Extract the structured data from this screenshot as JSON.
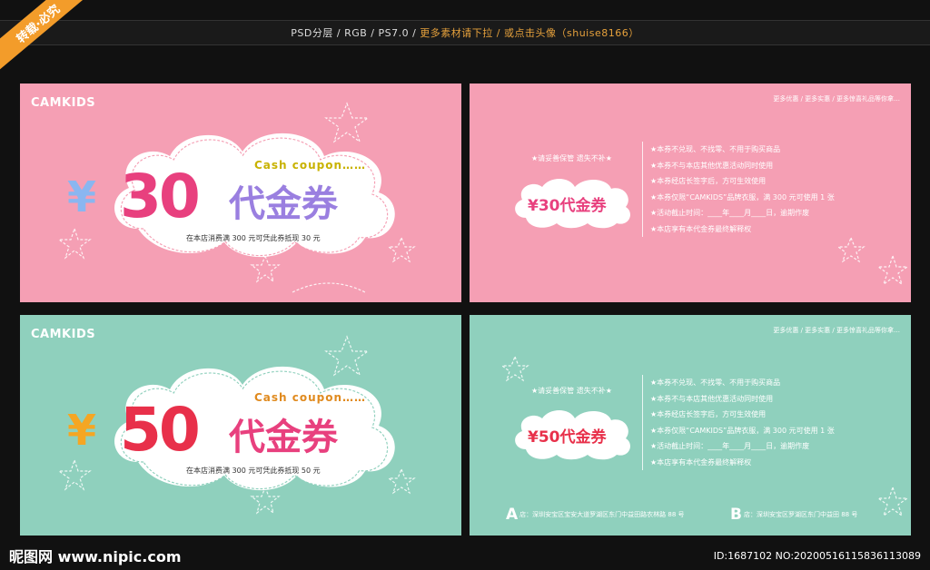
{
  "ribbon": "转载·必究",
  "topbar": {
    "specs": "PSD分层 / RGB / PS7.0 / ",
    "more": "更多素材请下拉 / 或点击头像（shuise8166）"
  },
  "cards": {
    "front30": {
      "brand": "CAMKIDS",
      "cash": "Cash coupon……",
      "yen": "¥",
      "amount": "30",
      "title": "代金券",
      "note": "在本店消费满 300 元可凭此券抵现 30 元"
    },
    "back30": {
      "links": "更多优惠 / 更多实惠 / 更多惊喜礼品等你拿…",
      "keep": "★请妥善保管 遗失不补★",
      "mini": "¥30代金券",
      "rules": [
        "★本券不兑现、不找零、不用于购买商品",
        "★本券不与本店其他优惠活动同时使用",
        "★本券经店长签字后，方可生效使用",
        "★本券仅限“CAMKIDS”品牌衣服，满 300 元可使用 1 张",
        "★活动截止时间：____年____月____日，逾期作废",
        "★本店享有本代金券最终解释权"
      ]
    },
    "front50": {
      "brand": "CAMKIDS",
      "cash": "Cash coupon……",
      "yen": "¥",
      "amount": "50",
      "title": "代金券",
      "note": "在本店消费满 300 元可凭此券抵现 50 元"
    },
    "back50": {
      "links": "更多优惠 / 更多实惠 / 更多惊喜礼品等你拿…",
      "keep": "★请妥善保管 遗失不补★",
      "mini": "¥50代金券",
      "rules": [
        "★本券不兑现、不找零、不用于购买商品",
        "★本券不与本店其他优惠活动同时使用",
        "★本券经店长签字后，方可生效使用",
        "★本券仅限“CAMKIDS”品牌衣服，满 300 元可使用 1 张",
        "★活动截止时间：____年____月____日，逾期作废",
        "★本店享有本代金券最终解释权"
      ],
      "addrA_letter": "A",
      "addrA": "店：深圳安宝区宝安大道罗湖区东门中益田路农林路 88 号",
      "addrB_letter": "B",
      "addrB": "店：深圳安宝区罗湖区东门中益田 88 号"
    }
  },
  "footer": {
    "logo": "昵图网 www.nipic.com",
    "id": "ID:1687102 NO:20200516115836113089"
  },
  "colors": {
    "pink": "#f59fb4",
    "mint": "#8fd0bd",
    "orange": "#f39c2a",
    "red": "#e8304a",
    "magenta": "#e8407e"
  }
}
